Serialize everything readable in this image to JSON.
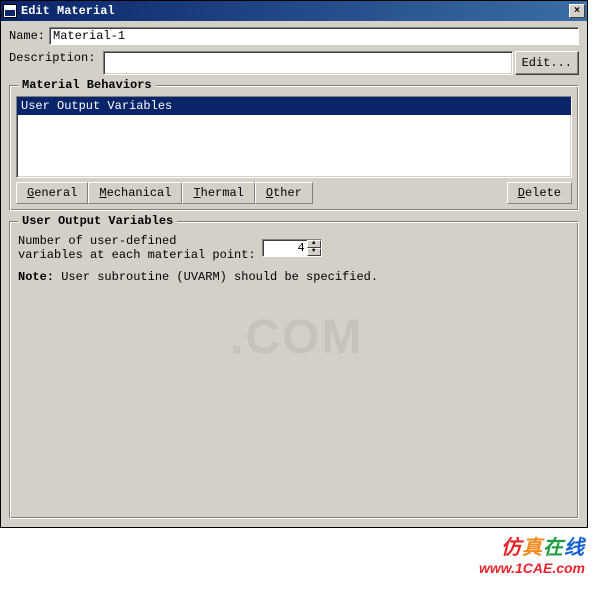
{
  "title": "Edit Material",
  "close_glyph": "×",
  "name_label": "Name:",
  "name_value": "Material-1",
  "desc_label": "Description:",
  "edit_btn": "Edit...",
  "behaviors_title": "Material Behaviors",
  "behaviors_item": "User Output Variables",
  "menu": {
    "general": "General",
    "mechanical": "Mechanical",
    "thermal": "Thermal",
    "other": "Other",
    "delete": "Delete"
  },
  "uov_title": "User Output Variables",
  "uov_label_line1": "Number of user-defined",
  "uov_label_line2": "variables at each material point:",
  "uov_value": "4",
  "note_label": "Note:",
  "note_text": " User subroutine (UVARM) should be specified.",
  "watermark_cn": "仿真在线",
  "watermark_url": "www.1CAE.com",
  "faint_wm": ".COM"
}
